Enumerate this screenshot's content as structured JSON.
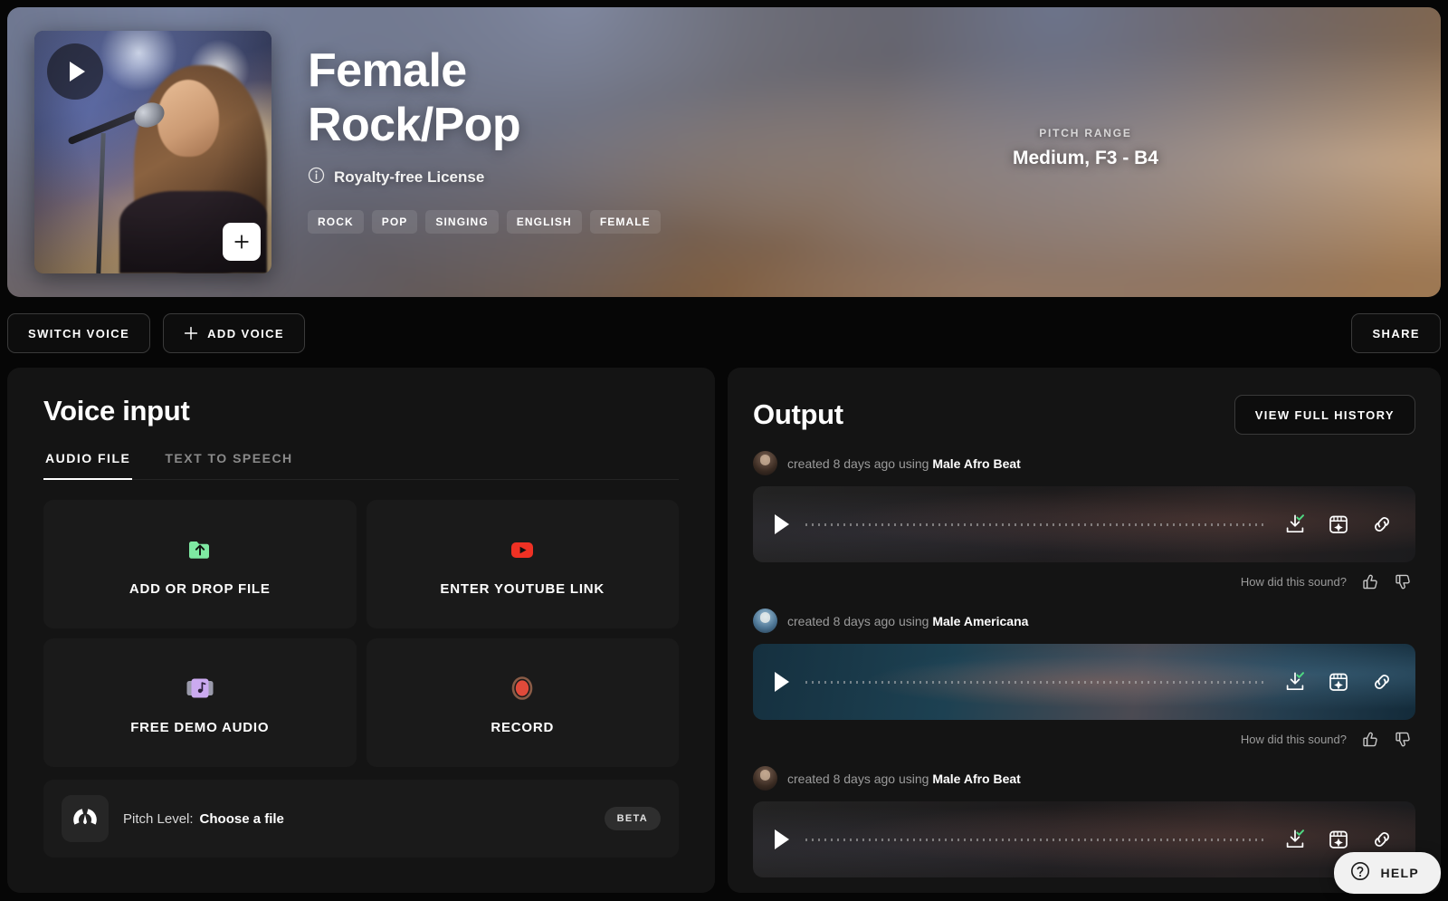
{
  "hero": {
    "title": "Female Rock/Pop",
    "license": "Royalty-free License",
    "info_icon": "info-circle-icon",
    "play_icon": "play-icon",
    "add_icon": "plus-icon",
    "tags": [
      "ROCK",
      "POP",
      "SINGING",
      "ENGLISH",
      "FEMALE"
    ],
    "pitch_label": "PITCH RANGE",
    "pitch_value": "Medium, F3 - B4"
  },
  "actionbar": {
    "switch_voice": "SWITCH VOICE",
    "add_voice": "ADD VOICE",
    "add_voice_icon": "plus-icon",
    "share": "SHARE"
  },
  "voice_input": {
    "heading": "Voice input",
    "tabs": [
      {
        "label": "AUDIO FILE",
        "active": true
      },
      {
        "label": "TEXT TO SPEECH",
        "active": false
      }
    ],
    "cards": [
      {
        "label": "ADD OR DROP FILE",
        "icon": "folder-upload-icon",
        "color": "#7ee8a2"
      },
      {
        "label": "ENTER YOUTUBE LINK",
        "icon": "youtube-icon",
        "color": "#ef3124"
      },
      {
        "label": "FREE DEMO AUDIO",
        "icon": "music-cassette-icon",
        "color": "#cbaaf0"
      },
      {
        "label": "RECORD",
        "icon": "record-icon",
        "color": "#e04a3a"
      }
    ],
    "pitch_level": {
      "icon": "gauge-icon",
      "label": "Pitch Level:",
      "value": "Choose a file",
      "badge": "BETA"
    }
  },
  "output": {
    "heading": "Output",
    "history_button": "VIEW FULL HISTORY",
    "feedback_label": "How did this sound?",
    "thumbs_up_icon": "thumbs-up-icon",
    "thumbs_down_icon": "thumbs-down-icon",
    "action_icons": [
      "download-check-icon",
      "studio-sparkle-icon",
      "link-icon"
    ],
    "rows": [
      {
        "created": "created 8 days ago using",
        "voice": "Male Afro Beat",
        "avatar": "avatar-afro-beat",
        "style": "dark",
        "has_feedback": true
      },
      {
        "created": "created 8 days ago using",
        "voice": "Male Americana",
        "avatar": "avatar-americana",
        "style": "blue",
        "has_feedback": true
      },
      {
        "created": "created 8 days ago using",
        "voice": "Male Afro Beat",
        "avatar": "avatar-afro-beat",
        "style": "dark",
        "has_feedback": false
      }
    ]
  },
  "help": {
    "label": "HELP",
    "icon": "question-circle-icon"
  }
}
